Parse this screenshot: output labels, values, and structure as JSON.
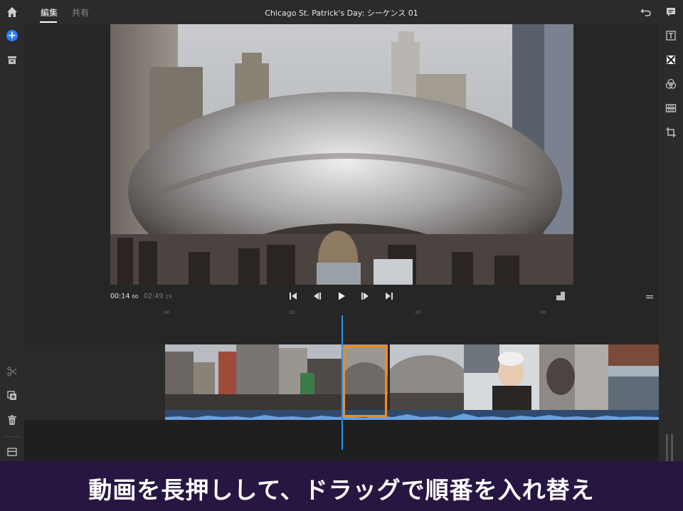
{
  "app": {
    "title": "Chicago St. Patrick's Day: シーケンス 01",
    "tabs": [
      {
        "label": "編集",
        "active": true
      },
      {
        "label": "共有",
        "active": false
      }
    ]
  },
  "left_toolbar": {
    "icons": [
      "home-icon",
      "add-media-icon",
      "project-panel-icon",
      "split-clip-icon",
      "duplicate-clip-icon",
      "delete-icon",
      "tracks-icon"
    ]
  },
  "right_toolbar": {
    "icons": [
      "titles-icon",
      "transitions-icon",
      "color-icon",
      "speed-icon",
      "crop-icon"
    ]
  },
  "player": {
    "current_time": "00:14",
    "current_frame": "00",
    "duration": "02:49",
    "duration_frame": "19",
    "controls": [
      "go-to-start-icon",
      "step-back-icon",
      "play-icon",
      "step-forward-icon",
      "go-to-end-icon"
    ],
    "aspect_icon": "aspect-ratio-icon"
  },
  "timeline": {
    "ruler_marks": [
      ":00",
      ":10",
      ":20",
      ":30"
    ],
    "clips": [
      {
        "name": "clip-city-street"
      },
      {
        "name": "clip-bean-closeup",
        "selected": true
      },
      {
        "name": "clip-bean-wide"
      },
      {
        "name": "clip-woman-winter"
      },
      {
        "name": "clip-pillar"
      },
      {
        "name": "clip-river"
      }
    ]
  },
  "caption": "動画を長押しして、ドラッグで順番を入れ替え",
  "colors": {
    "accent": "#2d7ff9",
    "selection": "#f28c13",
    "playhead": "#2e8fe8",
    "banner": "#271641"
  }
}
